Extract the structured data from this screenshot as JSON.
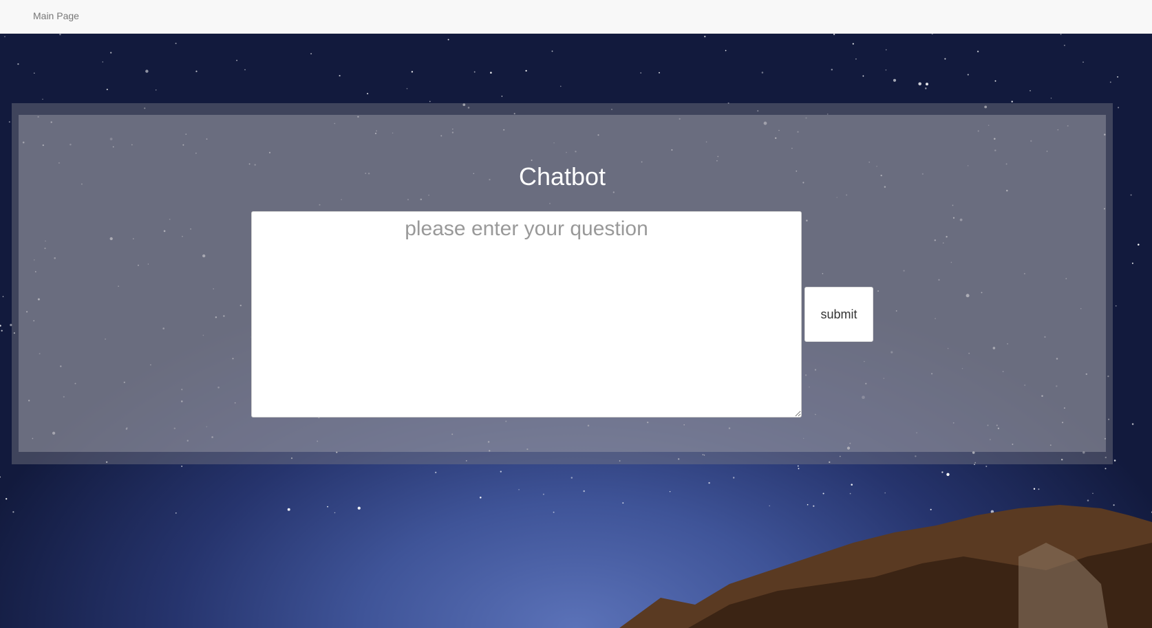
{
  "navbar": {
    "main_page_link": "Main Page"
  },
  "chatbot": {
    "title": "Chatbot",
    "question_placeholder": "please enter your question",
    "question_value": "",
    "submit_label": "submit"
  }
}
